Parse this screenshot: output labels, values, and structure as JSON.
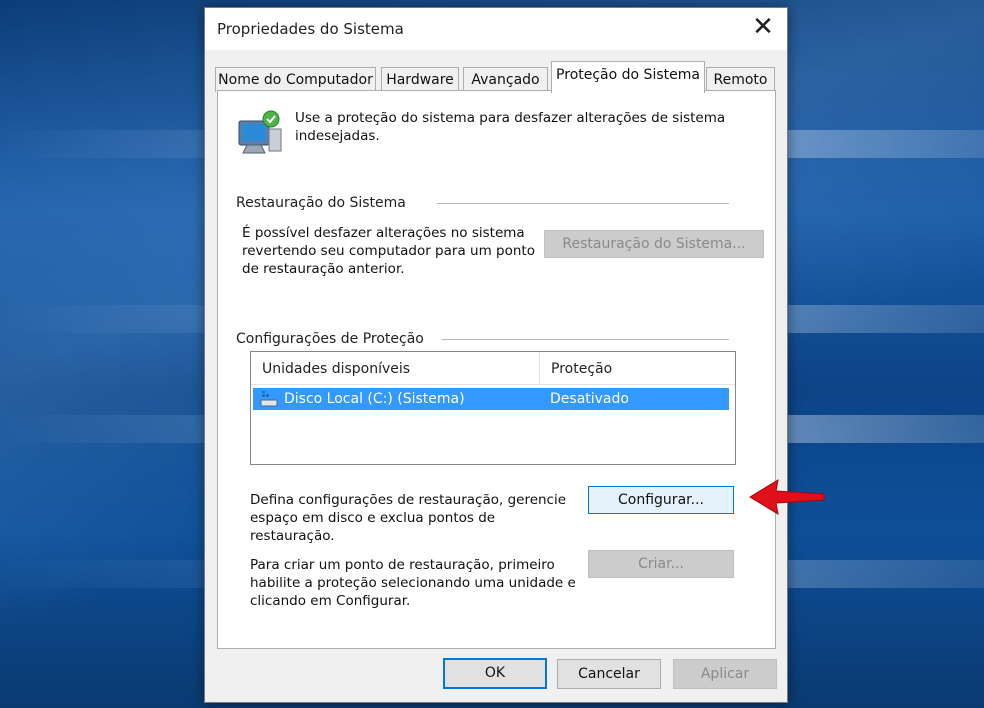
{
  "window": {
    "title": "Propriedades do Sistema",
    "close_glyph": "✕"
  },
  "tabs": [
    {
      "label": "Nome do Computador",
      "active": false
    },
    {
      "label": "Hardware",
      "active": false
    },
    {
      "label": "Avançado",
      "active": false
    },
    {
      "label": "Proteção do Sistema",
      "active": true
    },
    {
      "label": "Remoto",
      "active": false
    }
  ],
  "intro": {
    "icon": "system-protection-icon",
    "text": "Use a proteção do sistema para desfazer alterações de sistema indesejadas."
  },
  "restore": {
    "group_title": "Restauração do Sistema",
    "description": "É possível desfazer alterações no sistema revertendo seu computador para um ponto de restauração anterior.",
    "button_label": "Restauração do Sistema...",
    "button_enabled": false
  },
  "protection": {
    "group_title": "Configurações de Proteção",
    "columns": [
      "Unidades disponíveis",
      "Proteção"
    ],
    "rows": [
      {
        "drive": "Disco Local (C:) (Sistema)",
        "status": "Desativado",
        "selected": true,
        "icon": "drive-icon"
      }
    ],
    "configure_text": "Defina configurações de restauração, gerencie espaço em disco e exclua pontos de restauração.",
    "configure_button": "Configurar...",
    "create_text": "Para criar um ponto de restauração, primeiro habilite a proteção selecionando uma unidade e clicando em Configurar.",
    "create_button": "Criar..."
  },
  "footer": {
    "ok": "OK",
    "cancel": "Cancelar",
    "apply": "Aplicar"
  },
  "colors": {
    "selection": "#3399ff",
    "focus_border": "#0078d7",
    "annotation_arrow": "#e0101b"
  }
}
